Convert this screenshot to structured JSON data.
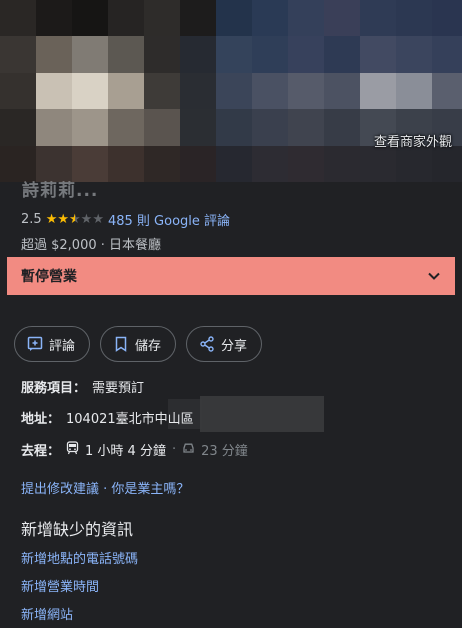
{
  "photo": {
    "see_outside_label": "查看商家外觀",
    "title": "詩莉莉..."
  },
  "rating": {
    "score": "2.5",
    "stars_value": 2.5,
    "stars_max": 5,
    "reviews_label": "485 則 Google 評論"
  },
  "meta": "超過 $2,000 · 日本餐廳",
  "closed": {
    "label": "暫停營業",
    "color": "#f28b82"
  },
  "actions": [
    {
      "label": "評論",
      "icon": "review-icon"
    },
    {
      "label": "儲存",
      "icon": "bookmark-icon"
    },
    {
      "label": "分享",
      "icon": "share-icon"
    }
  ],
  "info": {
    "service": {
      "key": "服務項目：",
      "value": "需要預訂"
    },
    "address": {
      "key": "地址：",
      "value": "104021臺北市中山區"
    },
    "directions": {
      "key": "去程：",
      "transit": "1 小時 4 分鐘",
      "sep": "·",
      "drive": "23 分鐘"
    }
  },
  "suggest": "提出修改建議 · 你是業主嗎？",
  "missing": {
    "title": "新增缺少的資訊",
    "links": [
      "新增地點的電話號碼",
      "新增營業時間",
      "新增網站"
    ]
  },
  "colors": {
    "background": "#202124",
    "link": "#8ab4f8",
    "star": "#fbbc04",
    "closed_banner": "#f28b82"
  }
}
